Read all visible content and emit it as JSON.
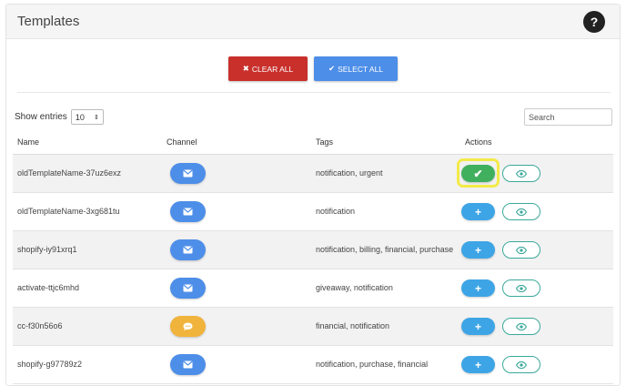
{
  "header": {
    "title": "Templates",
    "help_label": "?"
  },
  "toolbar": {
    "clear_all_label": "CLEAR ALL",
    "select_all_label": "SELECT ALL"
  },
  "controls": {
    "show_entries_label": "Show entries",
    "entries_value": "10",
    "search_placeholder": "Search"
  },
  "columns": {
    "name": "Name",
    "channel": "Channel",
    "tags": "Tags",
    "actions": "Actions"
  },
  "rows": [
    {
      "name": "oldTemplateName-37uz6exz",
      "channel": "email",
      "tags": "notification, urgent",
      "selected": true
    },
    {
      "name": "oldTemplateName-3xg681tu",
      "channel": "email",
      "tags": "notification",
      "selected": false
    },
    {
      "name": "shopify-iy91xrq1",
      "channel": "email",
      "tags": "notification, billing, financial, purchase",
      "selected": false
    },
    {
      "name": "activate-ttjc6mhd",
      "channel": "email",
      "tags": "giveaway, notification",
      "selected": false
    },
    {
      "name": "cc-f30n56o6",
      "channel": "sms",
      "tags": "financial, notification",
      "selected": false
    },
    {
      "name": "shopify-g97789z2",
      "channel": "email",
      "tags": "notification, purchase, financial",
      "selected": false
    }
  ],
  "icons": {
    "clear": "x-icon",
    "select": "double-check-icon",
    "email": "envelope-icon",
    "sms": "chat-bubble-icon",
    "add": "plus-icon",
    "selected": "check-icon",
    "view": "eye-icon"
  },
  "colors": {
    "danger": "#c9302c",
    "primary": "#4d8ee8",
    "add": "#3da5e6",
    "success": "#41b05e",
    "sms": "#f0b43c",
    "view_border": "#3aa89a",
    "highlight": "#f3ea4a"
  }
}
